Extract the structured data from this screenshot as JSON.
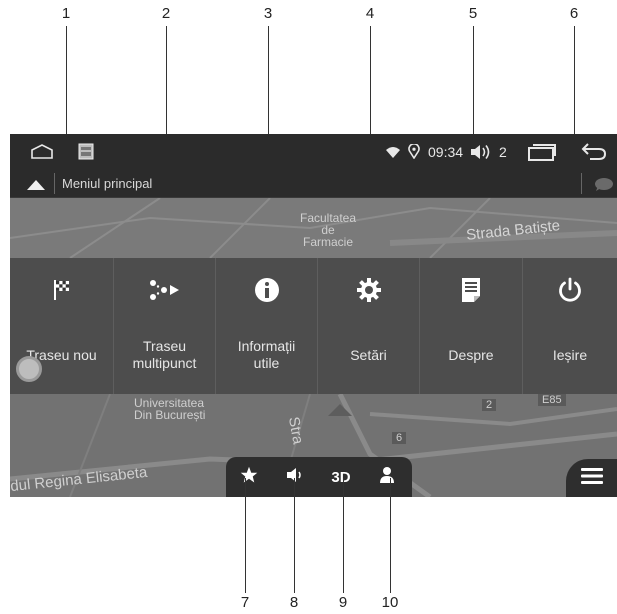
{
  "callouts_top": [
    "1",
    "2",
    "3",
    "4",
    "5",
    "6"
  ],
  "callouts_bottom": [
    "7",
    "8",
    "9",
    "10"
  ],
  "statusbar": {
    "time": "09:34",
    "volume_level": "2"
  },
  "titlebar": {
    "title": "Meniul principal"
  },
  "map_labels": {
    "faculty": "Facultatea\nde\nFarmacie",
    "street_top": "Strada Batiște",
    "university": "Universitatea\nDin București",
    "street_mid": "Stra",
    "street_bottom": "dul Regina Elisabeta",
    "road_badge_1": "2",
    "road_badge_2": "6",
    "road_badge_3": "E85"
  },
  "menu": {
    "items": [
      {
        "label": "Traseu nou",
        "icon": "checkered-flag-icon"
      },
      {
        "label": "Traseu\nmultipunct",
        "icon": "multipoint-route-icon"
      },
      {
        "label": "Informații\nutile",
        "icon": "info-icon"
      },
      {
        "label": "Setări",
        "icon": "gear-icon"
      },
      {
        "label": "Despre",
        "icon": "document-icon"
      },
      {
        "label": "Ieșire",
        "icon": "power-icon"
      }
    ]
  },
  "toolbar": {
    "favorites_icon": "star-icon",
    "sound_icon": "speaker-icon",
    "view_mode_label": "3D",
    "profile_icon": "user-icon"
  },
  "colors": {
    "bar_bg": "#2b2b2b",
    "menu_bg": "#4d4d4d",
    "map_bg": "#727272",
    "text": "#e6e6e6"
  }
}
